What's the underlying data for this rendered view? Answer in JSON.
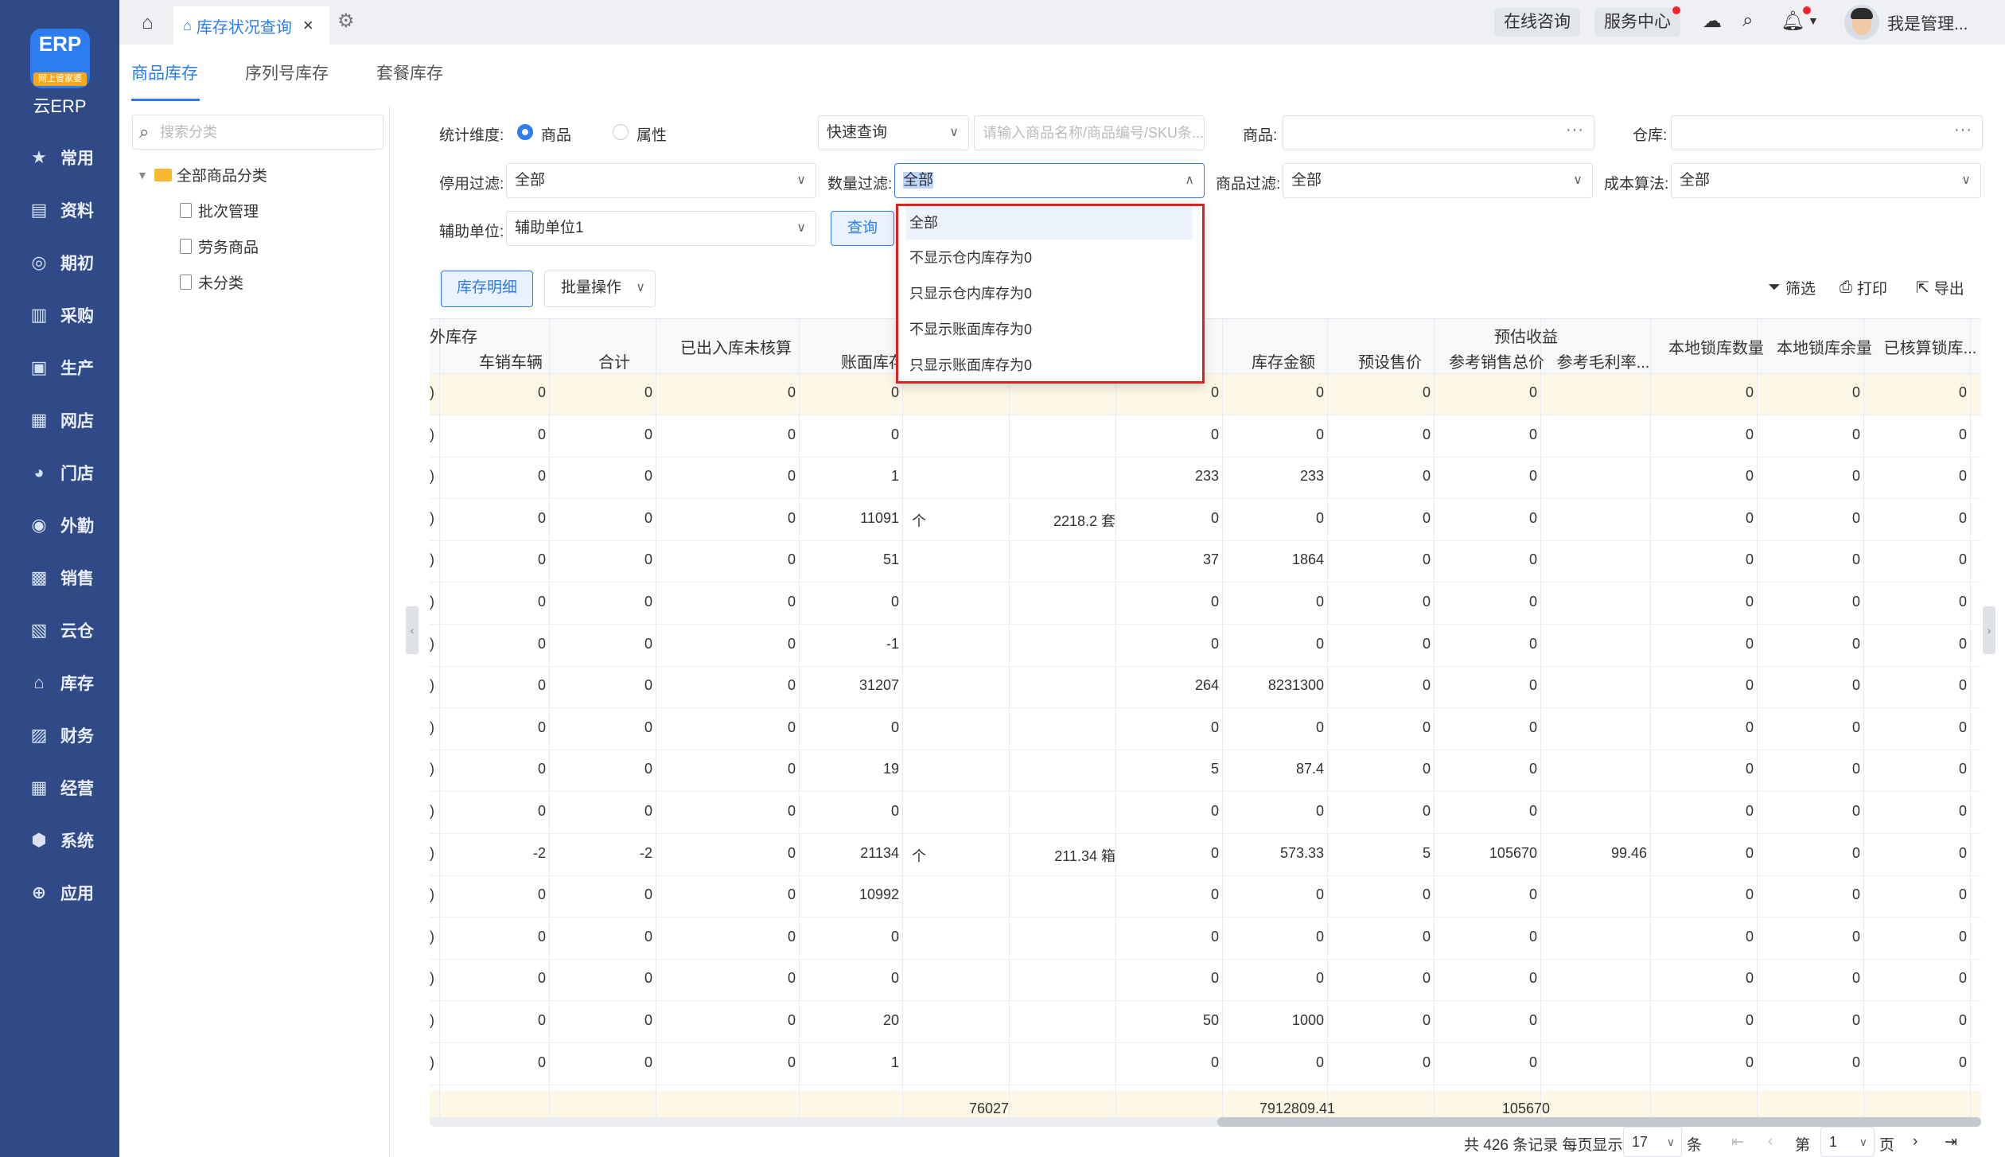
{
  "brand": {
    "logo_mark": "ERP",
    "logo_tag": "网上管家婆",
    "name": "云ERP"
  },
  "nav": [
    {
      "label": "常用",
      "icon": "star-icon"
    },
    {
      "label": "资料",
      "icon": "document-icon"
    },
    {
      "label": "期初",
      "icon": "target-icon"
    },
    {
      "label": "采购",
      "icon": "purchase-icon"
    },
    {
      "label": "生产",
      "icon": "production-icon"
    },
    {
      "label": "网店",
      "icon": "store-icon"
    },
    {
      "label": "门店",
      "icon": "pie-icon"
    },
    {
      "label": "外勤",
      "icon": "field-icon"
    },
    {
      "label": "销售",
      "icon": "sales-icon"
    },
    {
      "label": "云仓",
      "icon": "warehouse-icon"
    },
    {
      "label": "库存",
      "icon": "inventory-icon"
    },
    {
      "label": "财务",
      "icon": "finance-icon"
    },
    {
      "label": "经营",
      "icon": "business-icon"
    },
    {
      "label": "系统",
      "icon": "system-icon"
    },
    {
      "label": "应用",
      "icon": "apps-icon"
    }
  ],
  "topbar": {
    "tab_label": "库存状况查询",
    "online_consult": "在线咨询",
    "service_center": "服务中心",
    "user_name": "我是管理..."
  },
  "subtabs": [
    "商品库存",
    "序列号库存",
    "套餐库存"
  ],
  "left": {
    "search_placeholder": "搜索分类",
    "tree_root": "全部商品分类",
    "tree_items": [
      "批次管理",
      "劳务商品",
      "未分类"
    ]
  },
  "filters": {
    "dimension_label": "统计维度:",
    "dimension_options": [
      "商品",
      "属性"
    ],
    "quick_query": "快速查询",
    "search_placeholder": "请输入商品名称/商品编号/SKU条...",
    "product_label": "商品:",
    "warehouse_label": "仓库:",
    "disable_label": "停用过滤:",
    "disable_value": "全部",
    "qty_label": "数量过滤:",
    "qty_value": "全部",
    "product_filter_label": "商品过滤:",
    "product_filter_value": "全部",
    "cost_label": "成本算法:",
    "cost_value": "全部",
    "unit_label": "辅助单位:",
    "unit_value": "辅助单位1",
    "query_btn": "查询"
  },
  "toolbar": {
    "detail_btn": "库存明细",
    "batch_btn": "批量操作",
    "filter": "筛选",
    "print": "打印",
    "export": "导出"
  },
  "dropdown": {
    "options": [
      "全部",
      "不显示仓内库存为0",
      "只显示仓内库存为0",
      "不显示账面库存为0",
      "只显示账面库存为0"
    ],
    "selected": "全部"
  },
  "table": {
    "group_headers": [
      "外库存",
      "预估收益"
    ],
    "headers": [
      "车销车辆",
      "合计",
      "已出入库未核算",
      "账面库存",
      "库存金额",
      "预设售价",
      "参考销售总价",
      "参考毛利率...",
      "本地锁库数量",
      "本地锁库余量",
      "已核算锁库..."
    ],
    "rows": [
      [
        "0",
        "0",
        "0",
        "0",
        "",
        "",
        "0",
        "0",
        "0",
        "0",
        "",
        "0",
        "0",
        "0"
      ],
      [
        "0",
        "0",
        "0",
        "0",
        "",
        "",
        "0",
        "0",
        "0",
        "0",
        "",
        "0",
        "0",
        "0"
      ],
      [
        "0",
        "0",
        "0",
        "1",
        "",
        "",
        "233",
        "233",
        "0",
        "0",
        "",
        "0",
        "0",
        "0"
      ],
      [
        "0",
        "0",
        "0",
        "11091",
        "个",
        "2218.2 套",
        "0",
        "0",
        "0",
        "0",
        "",
        "0",
        "0",
        "0"
      ],
      [
        "0",
        "0",
        "0",
        "51",
        "",
        "",
        "37",
        "1864",
        "0",
        "0",
        "",
        "0",
        "0",
        "0"
      ],
      [
        "0",
        "0",
        "0",
        "0",
        "",
        "",
        "0",
        "0",
        "0",
        "0",
        "",
        "0",
        "0",
        "0"
      ],
      [
        "0",
        "0",
        "0",
        "-1",
        "",
        "",
        "0",
        "0",
        "0",
        "0",
        "",
        "0",
        "0",
        "0"
      ],
      [
        "0",
        "0",
        "0",
        "31207",
        "",
        "",
        "264",
        "8231300",
        "0",
        "0",
        "",
        "0",
        "0",
        "0"
      ],
      [
        "0",
        "0",
        "0",
        "0",
        "",
        "",
        "0",
        "0",
        "0",
        "0",
        "",
        "0",
        "0",
        "0"
      ],
      [
        "0",
        "0",
        "0",
        "19",
        "",
        "",
        "5",
        "87.4",
        "0",
        "0",
        "",
        "0",
        "0",
        "0"
      ],
      [
        "0",
        "0",
        "0",
        "0",
        "",
        "",
        "0",
        "0",
        "0",
        "0",
        "",
        "0",
        "0",
        "0"
      ],
      [
        "-2",
        "-2",
        "0",
        "21134",
        "个",
        "211.34 箱",
        "0",
        "573.33",
        "5",
        "105670",
        "99.46",
        "0",
        "0",
        "0"
      ],
      [
        "0",
        "0",
        "0",
        "10992",
        "",
        "",
        "0",
        "0",
        "0",
        "0",
        "",
        "0",
        "0",
        "0"
      ],
      [
        "0",
        "0",
        "0",
        "0",
        "",
        "",
        "0",
        "0",
        "0",
        "0",
        "",
        "0",
        "0",
        "0"
      ],
      [
        "0",
        "0",
        "0",
        "0",
        "",
        "",
        "0",
        "0",
        "0",
        "0",
        "",
        "0",
        "0",
        "0"
      ],
      [
        "0",
        "0",
        "0",
        "20",
        "",
        "",
        "50",
        "1000",
        "0",
        "0",
        "",
        "0",
        "0",
        "0"
      ],
      [
        "0",
        "0",
        "0",
        "1",
        "",
        "",
        "0",
        "0",
        "0",
        "0",
        "",
        "0",
        "0",
        "0"
      ]
    ],
    "summary": {
      "book_stock": "76027",
      "amount": "7912809.41",
      "sales_total": "105670"
    }
  },
  "pager": {
    "total_text": "共 426 条记录 每页显示",
    "page_size": "17",
    "unit": "条",
    "page_prefix": "第",
    "page": "1",
    "page_suffix": "页"
  }
}
